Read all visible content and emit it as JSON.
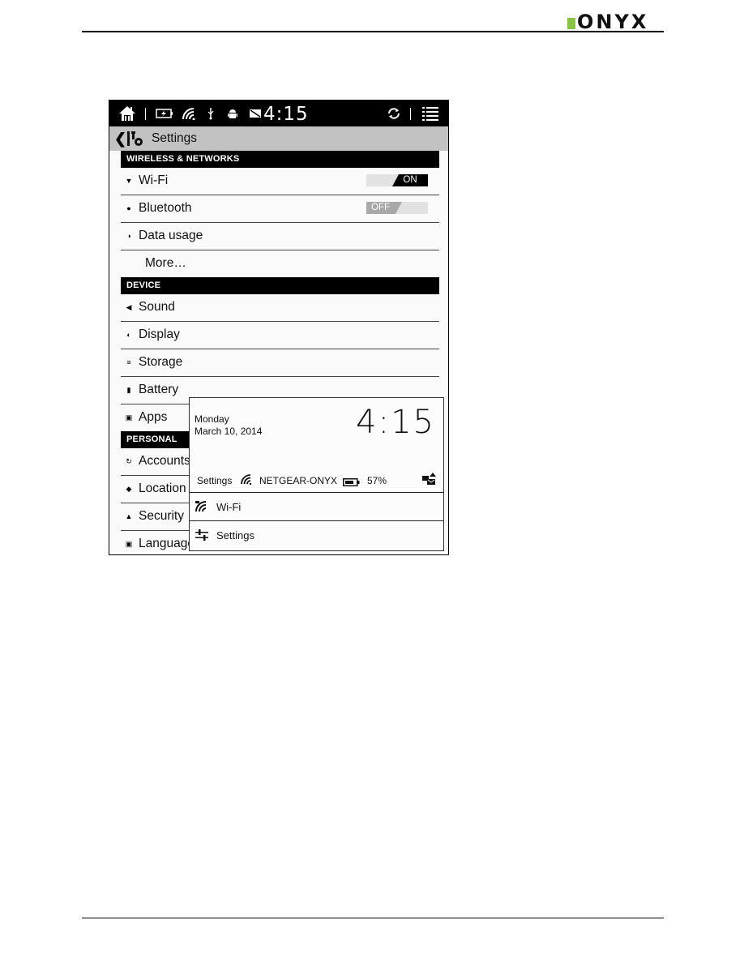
{
  "brand": {
    "name": "ONYX",
    "accent_color": "#8bc34a"
  },
  "statusbar": {
    "icons": [
      "home-icon",
      "battery-charging-icon",
      "wifi-icon",
      "usb-icon",
      "android-debug-icon",
      "message-icon",
      "sync-icon",
      "menu-icon"
    ],
    "time": "4:15"
  },
  "actionbar": {
    "back_icon": "chevron-left-icon",
    "title_icon": "settings-tools-icon",
    "title": "Settings"
  },
  "sections": [
    {
      "header": "WIRELESS & NETWORKS",
      "items": [
        {
          "label": "Wi-Fi",
          "icon": "wifi-icon",
          "toggle": "ON"
        },
        {
          "label": "Bluetooth",
          "icon": "bluetooth-icon",
          "toggle": "OFF"
        },
        {
          "label": "Data usage",
          "icon": "data-usage-icon"
        },
        {
          "label": "More…"
        }
      ]
    },
    {
      "header": "DEVICE",
      "items": [
        {
          "label": "Sound",
          "icon": "sound-icon"
        },
        {
          "label": "Display",
          "icon": "display-icon"
        },
        {
          "label": "Storage",
          "icon": "storage-icon"
        },
        {
          "label": "Battery",
          "icon": "battery-icon"
        },
        {
          "label": "Apps",
          "icon": "apps-icon"
        }
      ]
    },
    {
      "header": "PERSONAL",
      "items": [
        {
          "label": "Accounts",
          "icon": "sync-icon"
        },
        {
          "label": "Location",
          "icon": "location-icon"
        },
        {
          "label": "Security",
          "icon": "lock-icon"
        },
        {
          "label": "Language",
          "icon": "language-icon"
        }
      ]
    }
  ],
  "notification": {
    "day": "Monday",
    "date": "March 10, 2014",
    "time": "4:15",
    "status": {
      "label": "Settings",
      "ssid": "NETGEAR-ONYX",
      "battery_percent": "57%"
    },
    "rows": [
      {
        "label": "Wi-Fi",
        "icon": "wifi-icon"
      },
      {
        "label": "Settings",
        "icon": "sliders-icon"
      }
    ]
  }
}
